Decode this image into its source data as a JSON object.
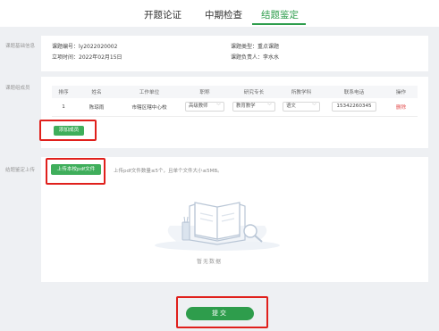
{
  "tabs": [
    {
      "label": "开题论证"
    },
    {
      "label": "中期检查"
    },
    {
      "label": "结题鉴定"
    }
  ],
  "sections": {
    "basic_info": "课题基础信息",
    "members": "课题组成员",
    "upload": "结题鉴定上传"
  },
  "project": {
    "number_label": "课题编号：",
    "number": "ly2022020002",
    "date_label": "立项时间：",
    "date": "2022年02月15日",
    "type_label": "课题类型：",
    "type": "重点课题",
    "owner_label": "课题负责人：",
    "owner": "李水水"
  },
  "members_table": {
    "headers": [
      "排序",
      "姓名",
      "工作单位",
      "职称",
      "研究专长",
      "所教学科",
      "联系电话",
      "操作"
    ],
    "rows": [
      {
        "order": "1",
        "name": "陈琼雨",
        "unit": "市辖区辖中心校",
        "title": "高级教师",
        "specialty": "教育教学",
        "subject": "语文",
        "phone": "15342260345",
        "action": "删除"
      }
    ]
  },
  "add_member_label": "添加成员",
  "upload_button_label": "上传本校pdf文件",
  "upload_hint": "上传pdf文件数量≤5个，且单个文件大小≤5MB。",
  "empty_text": "暂无数据",
  "submit_label": "提交",
  "colors": {
    "primary_green": "#2e9d4c",
    "button_green": "#3fae5b",
    "highlight_red": "#e0201c",
    "delete_red": "#e34d4d"
  }
}
